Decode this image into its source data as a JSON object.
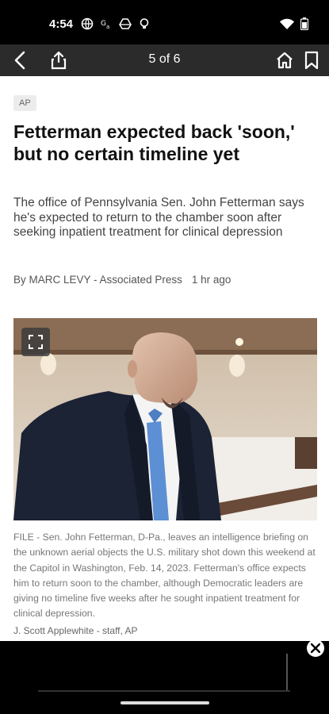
{
  "status_bar": {
    "time": "4:54",
    "left_icons": [
      "globe-icon",
      "translate-icon",
      "drive-icon",
      "lightbulb-icon"
    ],
    "right_icons": [
      "wifi-icon",
      "battery-icon"
    ]
  },
  "toolbar": {
    "page_indicator": "5 of 6",
    "icons": [
      "back-icon",
      "share-icon",
      "home-icon",
      "bookmark-icon"
    ]
  },
  "article": {
    "source": "AP",
    "headline": "Fetterman expected back 'soon,' but no certain timeline yet",
    "summary": "The office of Pennsylvania Sen. John Fetterman says he's expected to return to the chamber soon after seeking inpatient treatment for clinical depression",
    "byline": "By MARC LEVY - Associated Press",
    "time_ago": "1 hr ago",
    "caption": "FILE - Sen. John Fetterman, D-Pa., leaves an intelligence briefing on the unknown aerial objects the U.S. military shot down this weekend at the Capitol in Washington, Feb. 14, 2023. Fetterman's office expects him to return soon to the chamber, although Democratic leaders are giving no timeline five weeks after he sought inpatient treatment for clinical depression.",
    "credit": "J. Scott Applewhite - staff, AP"
  },
  "colors": {
    "toolbar_bg": "#2b2b2b",
    "status_bg": "#000000",
    "headline": "#111111",
    "caption": "#777777"
  }
}
